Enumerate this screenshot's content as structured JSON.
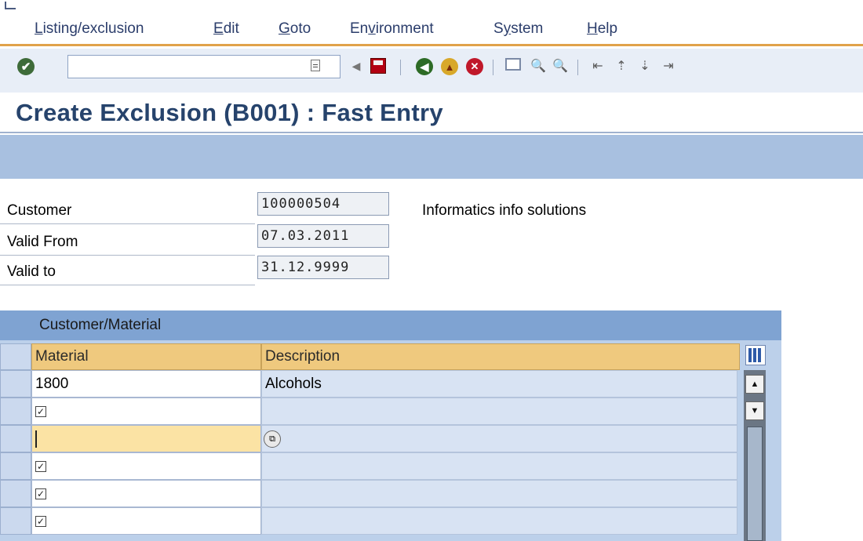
{
  "menu": {
    "items": [
      {
        "pre": "",
        "u": "L",
        "post": "isting/exclusion"
      },
      {
        "pre": "",
        "u": "E",
        "post": "dit"
      },
      {
        "pre": "",
        "u": "G",
        "post": "oto"
      },
      {
        "pre": "En",
        "u": "v",
        "post": "ironment"
      },
      {
        "pre": "S",
        "u": "y",
        "post": "stem"
      },
      {
        "pre": "",
        "u": "H",
        "post": "elp"
      }
    ]
  },
  "toolbar": {
    "command_value": "",
    "enter_glyph": "✔",
    "back_glyph": "◀",
    "nav_back_glyph": "◀",
    "nav_exit_glyph": "▲",
    "nav_cancel_glyph": "✕",
    "find_glyph": "🔍",
    "page_glyphs": [
      "⇤",
      "⇡",
      "⇣",
      "⇥"
    ]
  },
  "title": "Create Exclusion (B001) : Fast Entry",
  "header": {
    "customer_label": "Customer",
    "customer_value": "100000504",
    "customer_name": "Informatics info solutions",
    "valid_from_label": "Valid From",
    "valid_from_value": "07.03.2011",
    "valid_to_label": "Valid to",
    "valid_to_value": "31.12.9999"
  },
  "table": {
    "title": "Customer/Material",
    "columns": [
      "Material",
      "Description"
    ],
    "rows": [
      {
        "material": "1800",
        "description": "Alcohols"
      },
      {
        "material": "",
        "description": ""
      },
      {
        "material": "",
        "description": ""
      },
      {
        "material": "",
        "description": ""
      },
      {
        "material": "",
        "description": ""
      },
      {
        "material": "",
        "description": ""
      }
    ],
    "check_glyph": "✓",
    "f4_glyph": "⧉",
    "scroll_up_glyph": "▲",
    "scroll_down_glyph": "▼"
  },
  "colors": {
    "title": "#26436c",
    "menu_text": "#2b3d6b",
    "menu_rule": "#e0a24a",
    "app_strip": "#a8c0e0",
    "table_header": "#efc97e",
    "active_cell": "#fbe3a4"
  }
}
